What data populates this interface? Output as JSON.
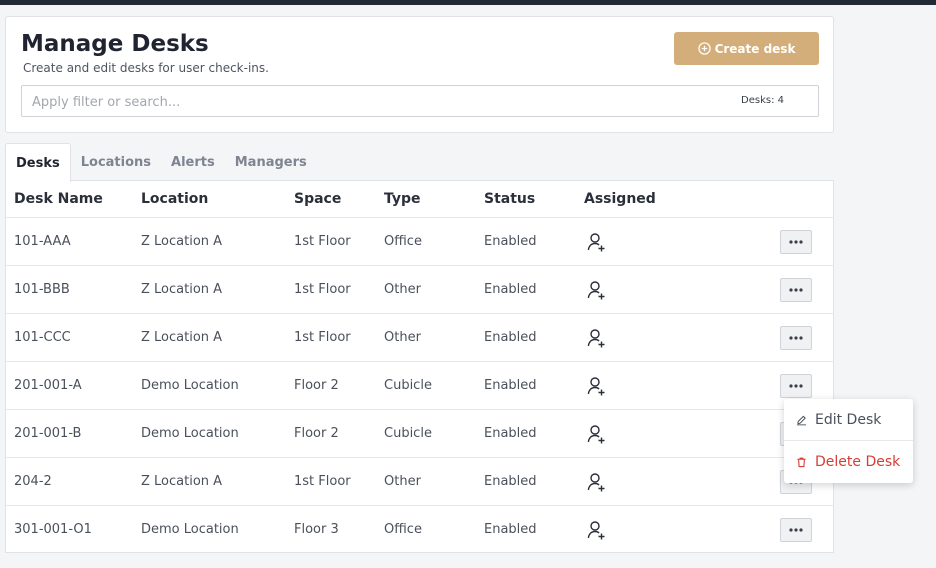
{
  "header": {
    "title": "Manage Desks",
    "subtitle": "Create and edit desks for user check-ins.",
    "create_button": "Create desk",
    "search_placeholder": "Apply filter or search...",
    "desk_count": "Desks: 4"
  },
  "tabs": [
    {
      "label": "Desks",
      "active": true
    },
    {
      "label": "Locations",
      "active": false
    },
    {
      "label": "Alerts",
      "active": false
    },
    {
      "label": "Managers",
      "active": false
    }
  ],
  "table": {
    "columns": [
      "Desk Name",
      "Location",
      "Space",
      "Type",
      "Status",
      "Assigned"
    ],
    "rows": [
      {
        "desk": "101-AAA",
        "location": "Z Location A",
        "space": "1st Floor",
        "type": "Office",
        "status": "Enabled"
      },
      {
        "desk": "101-BBB",
        "location": "Z Location A",
        "space": "1st Floor",
        "type": "Other",
        "status": "Enabled"
      },
      {
        "desk": "101-CCC",
        "location": "Z Location A",
        "space": "1st Floor",
        "type": "Other",
        "status": "Enabled"
      },
      {
        "desk": "201-001-A",
        "location": "Demo Location",
        "space": "Floor 2",
        "type": "Cubicle",
        "status": "Enabled"
      },
      {
        "desk": "201-001-B",
        "location": "Demo Location",
        "space": "Floor 2",
        "type": "Cubicle",
        "status": "Enabled"
      },
      {
        "desk": "204-2",
        "location": "Z Location A",
        "space": "1st Floor",
        "type": "Other",
        "status": "Enabled"
      },
      {
        "desk": "301-001-O1",
        "location": "Demo Location",
        "space": "Floor 3",
        "type": "Office",
        "status": "Enabled"
      }
    ]
  },
  "row_menu": {
    "edit_label": "Edit Desk",
    "delete_label": "Delete Desk"
  },
  "icons": {
    "create": "plus-circle-icon",
    "assigned": "add-user-icon",
    "more": "ellipsis-icon",
    "edit": "pencil-icon",
    "delete": "trash-icon"
  },
  "colors": {
    "accent": "#d3ae7a",
    "danger": "#d93c35"
  }
}
